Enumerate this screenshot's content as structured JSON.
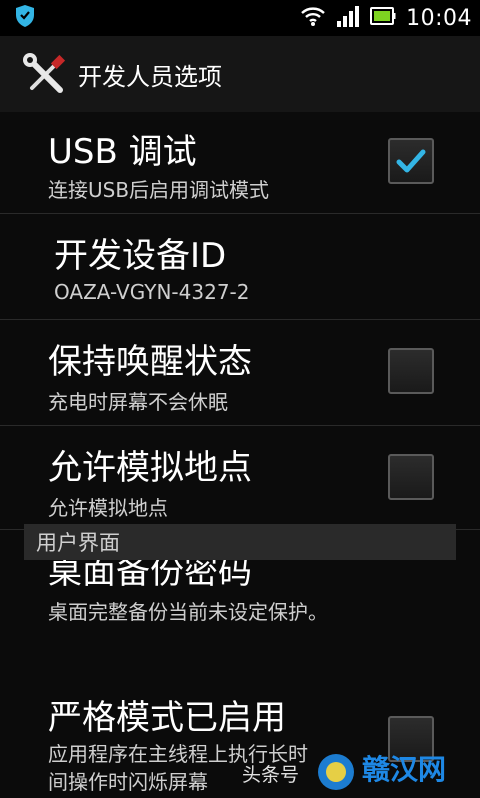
{
  "status_bar": {
    "time": "10:04",
    "icons": [
      "notification-shield-icon",
      "wifi-icon",
      "signal-icon",
      "battery-icon"
    ]
  },
  "title_bar": {
    "icon": "tools-icon",
    "title": "开发人员选项"
  },
  "settings": [
    {
      "title": "USB 调试",
      "subtitle": "连接USB后启用调试模式",
      "checked": true
    },
    {
      "title": "开发设备ID",
      "subtitle": "OAZA-VGYN-4327-2"
    },
    {
      "title": "保持唤醒状态",
      "subtitle": "充电时屏幕不会休眠",
      "checked": false
    },
    {
      "title": "允许模拟地点",
      "subtitle": "允许模拟地点",
      "checked": false
    },
    {
      "title": "桌面备份密码",
      "subtitle": "桌面完整备份当前未设定保护。"
    }
  ],
  "section_header": "用户界面",
  "strict_mode": {
    "title": "严格模式已启用",
    "subtitle_line1": "应用程序在主线程上执行长时",
    "subtitle_line2": "间操作时闪烁屏幕",
    "checked": false
  },
  "watermark": {
    "text": "赣汉网",
    "sub": "头条号"
  },
  "colors": {
    "background": "#0b0b0b",
    "accent": "#33b5e5",
    "title_bar": "#161616",
    "section": "#2a2a2a"
  }
}
